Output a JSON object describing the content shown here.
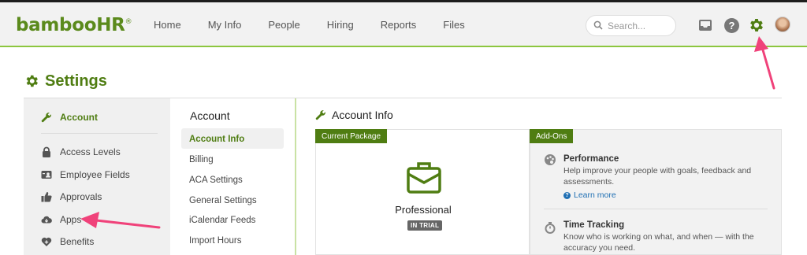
{
  "header": {
    "logo_text": "bambooHR",
    "nav": [
      "Home",
      "My Info",
      "People",
      "Hiring",
      "Reports",
      "Files"
    ],
    "search_placeholder": "Search...",
    "help_glyph": "?"
  },
  "page": {
    "title": "Settings"
  },
  "sidebar": {
    "items": [
      {
        "label": "Account",
        "icon": "wrench-icon",
        "active": true
      },
      {
        "label": "Access Levels",
        "icon": "lock-icon"
      },
      {
        "label": "Employee Fields",
        "icon": "id-card-icon"
      },
      {
        "label": "Approvals",
        "icon": "thumbs-up-icon"
      },
      {
        "label": "Apps",
        "icon": "cloud-icon"
      },
      {
        "label": "Benefits",
        "icon": "heart-icon"
      }
    ]
  },
  "submenu": {
    "heading": "Account",
    "items": [
      "Account Info",
      "Billing",
      "ACA Settings",
      "General Settings",
      "iCalendar Feeds",
      "Import Hours"
    ]
  },
  "account_info": {
    "heading": "Account Info",
    "package_tag": "Current Package",
    "package_name": "Professional",
    "package_status": "IN TRIAL",
    "addons_tag": "Add-Ons",
    "addons": [
      {
        "title": "Performance",
        "description": "Help improve your people with goals, feedback and assessments.",
        "link": "Learn more",
        "icon": "palette-icon"
      },
      {
        "title": "Time Tracking",
        "description": "Know who is working on what, and when — with the accuracy you need.",
        "icon": "stopwatch-icon"
      }
    ]
  },
  "colors": {
    "brand_green": "#4f7d12",
    "accent_green": "#8cc63f",
    "annotation_pink": "#f0427a",
    "link_blue": "#1f6fb3"
  }
}
